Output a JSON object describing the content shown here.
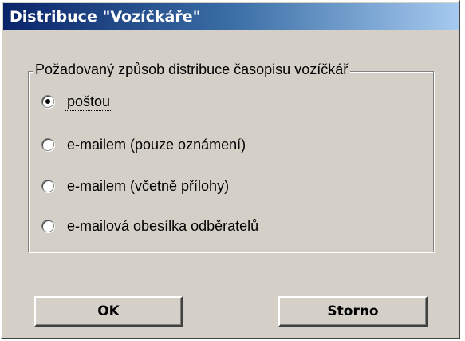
{
  "window": {
    "title": "Distribuce \"Vozíčkáře\""
  },
  "group": {
    "legend": "Požadovaný způsob distribuce časopisu vozíčkář"
  },
  "options": [
    {
      "label": "poštou",
      "selected": true
    },
    {
      "label": "e-mailem (pouze oznámení)",
      "selected": false
    },
    {
      "label": "e-mailem (včetně přílohy)",
      "selected": false
    },
    {
      "label": "e-mailová obesílka odběratelů",
      "selected": false
    }
  ],
  "buttons": {
    "ok_label": "OK",
    "cancel_label": "Storno"
  },
  "colors": {
    "dialog_background": "#d4d0c8",
    "titlebar_start": "#0a246a",
    "titlebar_end": "#a6caf0"
  }
}
